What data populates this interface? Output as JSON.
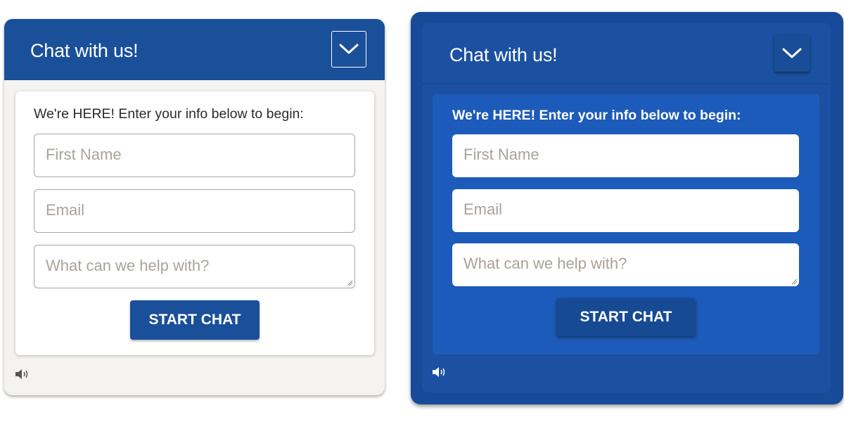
{
  "widgets": [
    {
      "theme": "light",
      "title": "Chat with us!",
      "prompt": "We're HERE! Enter your info below to begin:",
      "fields": {
        "first_name_placeholder": "First Name",
        "email_placeholder": "Email",
        "message_placeholder": "What can we help with?"
      },
      "start_label": "START CHAT",
      "icons": {
        "collapse": "chevron-down-icon",
        "sound": "speaker-icon"
      }
    },
    {
      "theme": "dark",
      "title": "Chat with us!",
      "prompt": "We're HERE! Enter your info below to begin:",
      "fields": {
        "first_name_placeholder": "First Name",
        "email_placeholder": "Email",
        "message_placeholder": "What can we help with?"
      },
      "start_label": "START CHAT",
      "icons": {
        "collapse": "chevron-down-icon",
        "sound": "speaker-icon"
      }
    }
  ],
  "colors": {
    "brand_blue": "#1a4f99",
    "dark_panel": "#174b99",
    "dark_card": "#1d5bba",
    "light_bg": "#f4f3f1",
    "placeholder_text": "#aaa39b"
  }
}
